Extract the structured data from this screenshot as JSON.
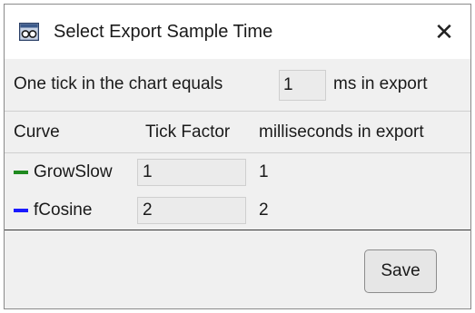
{
  "window": {
    "title": "Select Export Sample Time",
    "close_label": "✕",
    "icon": "app-window-icon"
  },
  "sample_row": {
    "prefix": "One tick in the chart equals",
    "value": "1",
    "suffix": "ms in export"
  },
  "table": {
    "headers": [
      "Curve",
      "Tick Factor",
      "milliseconds in export"
    ],
    "rows": [
      {
        "name": "GrowSlow",
        "color": "#1f8a1f",
        "tick_factor": "1",
        "ms": "1"
      },
      {
        "name": "fCosine",
        "color": "#1a1aff",
        "tick_factor": "2",
        "ms": "2"
      }
    ]
  },
  "actions": {
    "save_label": "Save"
  }
}
